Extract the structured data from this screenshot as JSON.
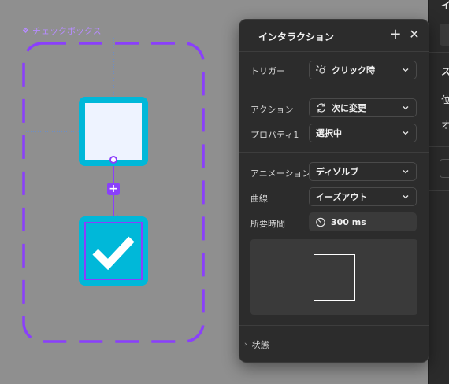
{
  "canvas": {
    "component_label": "チェックボックス",
    "selection_color": "#8a3ffc",
    "box_color": "#00b8d9"
  },
  "dialog": {
    "title": "インタラクション",
    "add_icon": "plus-icon",
    "close_icon": "close-icon",
    "trigger": {
      "label": "トリガー",
      "value": "クリック時",
      "icon": "click-sparkle-icon"
    },
    "action": {
      "label": "アクション",
      "value": "次に変更",
      "icon": "refresh-icon"
    },
    "property": {
      "label": "プロパティ1",
      "value": "選択中"
    },
    "animation": {
      "label": "アニメーション",
      "value": "ディゾルブ"
    },
    "curve": {
      "label": "曲線",
      "value": "イーズアウト"
    },
    "duration": {
      "label": "所要時間",
      "value": "300 ms",
      "icon": "timer-icon"
    },
    "state": {
      "label": "状態"
    }
  },
  "right_panel": {
    "top_char": "イ",
    "item_s": "ス",
    "item_pos": "位",
    "item_o": "オ"
  }
}
